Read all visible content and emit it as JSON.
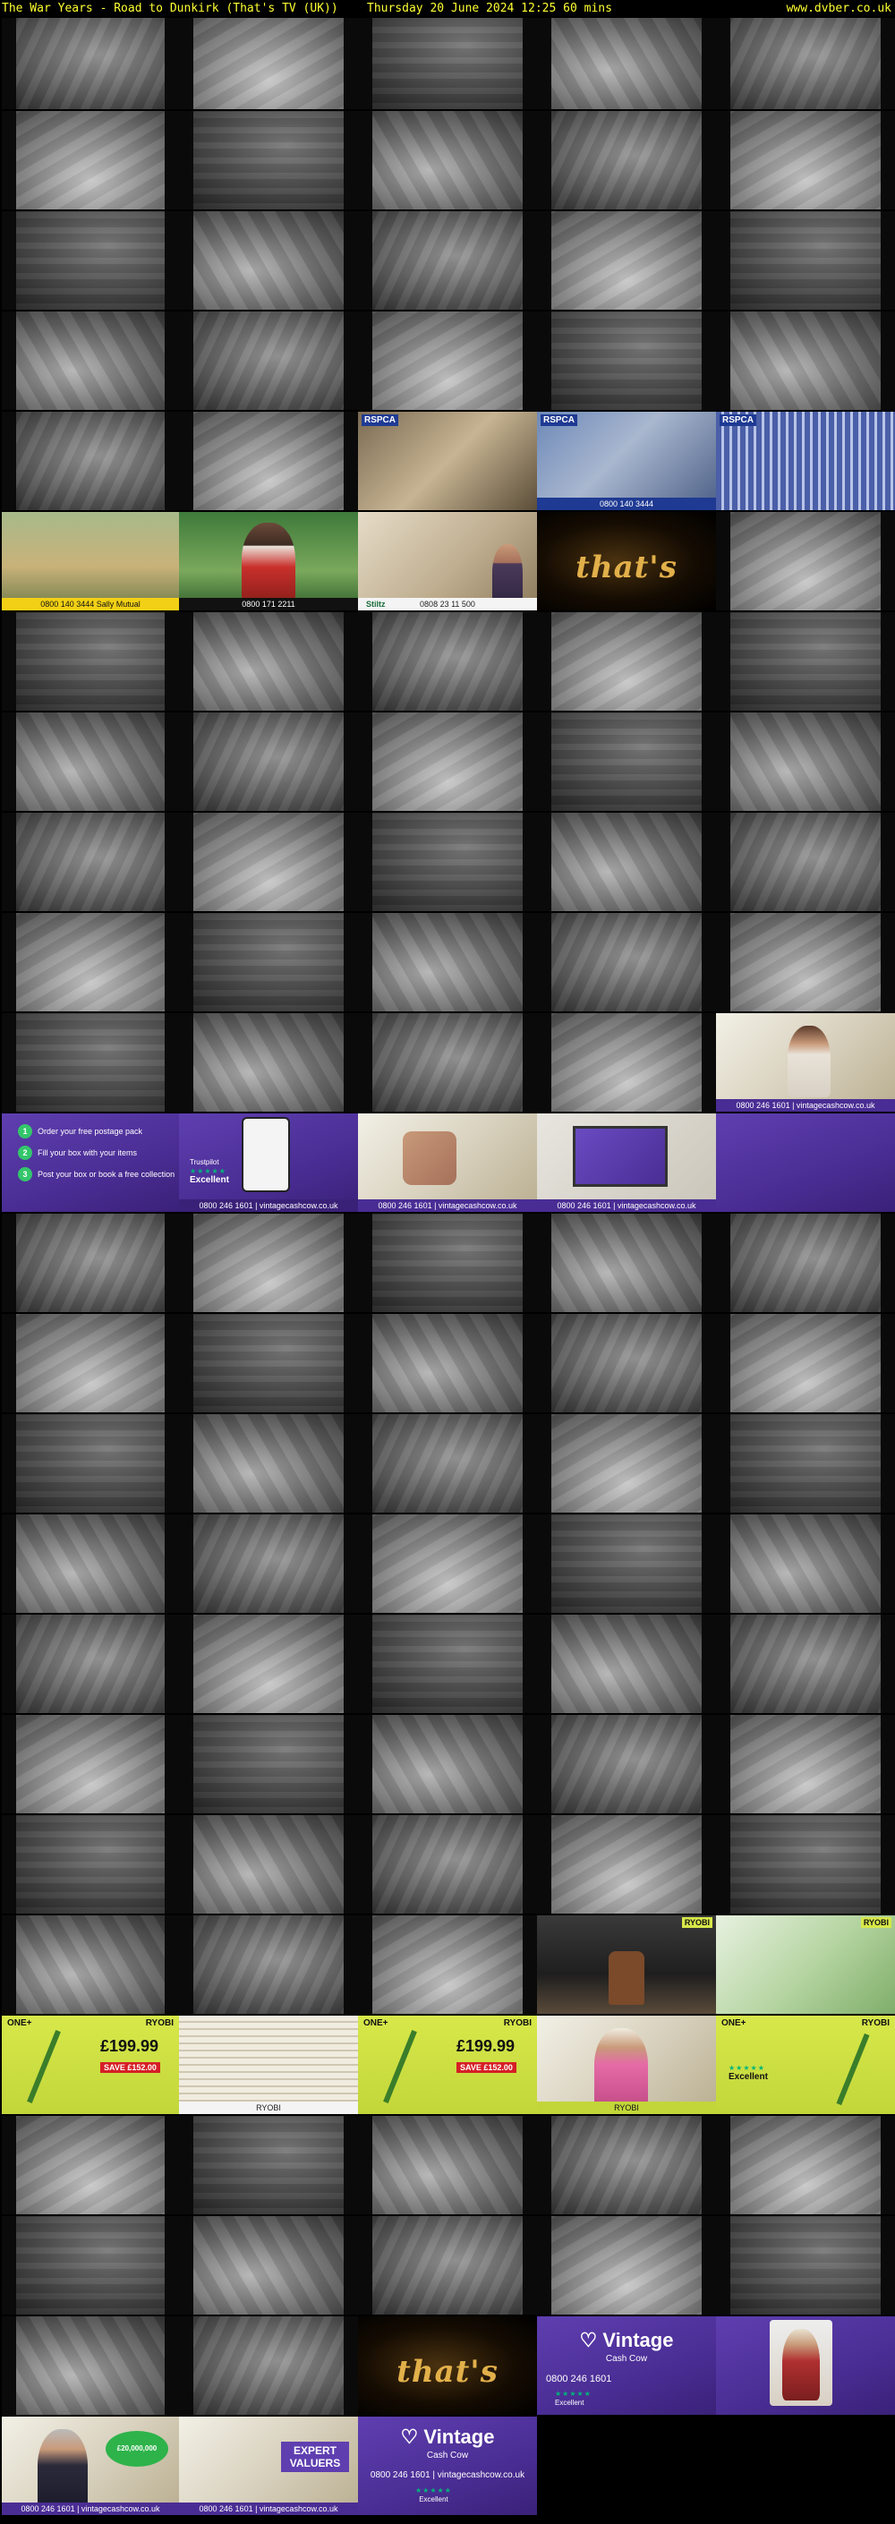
{
  "header": {
    "title": "The War Years - Road to Dunkirk (That's TV (UK))",
    "datetime": "Thursday 20 June 2024  12:25  60 mins",
    "site": "www.dvber.co.uk"
  },
  "thumbnails": {
    "columns": 5,
    "rows": 25,
    "total": 122,
    "ads": {
      "rspca_logo": "RSPCA",
      "motor_phone": "0800 140 3444",
      "motor_brand": "Sally Mutual",
      "redshirt_phone": "0800 171 2211",
      "stair_phone": "0808 23 11 500",
      "stair_brand": "Stiltz",
      "thats_logo": "that's",
      "vcc_brand": "Vintage",
      "vcc_sub": "Cash Cow",
      "vcc_phone": "0800 246 1601",
      "vcc_web": "vintagecashcow.co.uk",
      "vcc_contact": "0800 246 1601  |  vintagecashcow.co.uk",
      "vcc_steps": [
        "Order your free postage pack",
        "Fill your box with your items",
        "Post your box or book a free collection"
      ],
      "trustpilot": "Trustpilot",
      "excellent": "Excellent",
      "ryobi_brand": "RYOBI",
      "ryobi_oneplus": "ONE+",
      "ryobi_price": "£199.99",
      "ryobi_save": "SAVE £152.00",
      "ryobi_price2": "£20,000,000",
      "expert_valuers": "EXPERT VALUERS"
    }
  }
}
